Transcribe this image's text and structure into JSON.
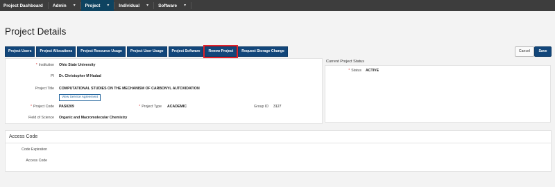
{
  "nav": {
    "brand": "Project Dashboard",
    "items": [
      {
        "label": "Admin",
        "has_caret": true
      },
      {
        "label": "Project",
        "has_caret": true,
        "active": true
      },
      {
        "label": "Individual",
        "has_caret": true
      },
      {
        "label": "Software",
        "has_caret": true
      }
    ],
    "caret_glyph": "▼"
  },
  "page": {
    "title": "Project Details"
  },
  "tabs": [
    "Project Users",
    "Project Allocations",
    "Project Resource Usage",
    "Project User Usage",
    "Project Software",
    "Renew Project",
    "Request Storage Change"
  ],
  "highlighted_tab": "Renew Project",
  "actions": {
    "cancel": "Cancel",
    "save": "Save"
  },
  "details": {
    "institution_label": "Institution",
    "institution_value": "Ohio State University",
    "pi_label": "PI",
    "pi_value": "Dr. Christopher M Hadad",
    "project_title_label": "Project Title",
    "project_title_value": "COMPUTATIONAL STUDIES ON THE MECHANISM OF CARBONYL AUTOXIDATION",
    "agreement_link": "View Service Agreement",
    "project_code_label": "Project Code",
    "project_code_value": "PAS0209",
    "project_type_label": "Project Type",
    "project_type_value": "ACADEMIC",
    "group_id_label": "Group ID",
    "group_id_value": "3127",
    "field_label": "Field of Science",
    "field_value": "Organic and Macromolecular Chemistry",
    "required_marker": "*"
  },
  "status": {
    "panel_title": "Current Project Status",
    "status_label": "Status",
    "status_value": "ACTIVE"
  },
  "access": {
    "title": "Access Code",
    "expiration_label": "Code Expiration",
    "expiration_value": "",
    "code_label": "Access Code",
    "code_value": ""
  },
  "colors": {
    "nav_bg": "#3d3d3d",
    "nav_active": "#0e4360",
    "button_blue": "#12467a",
    "highlight_red": "#e2222b",
    "required_red": "#d33333"
  }
}
